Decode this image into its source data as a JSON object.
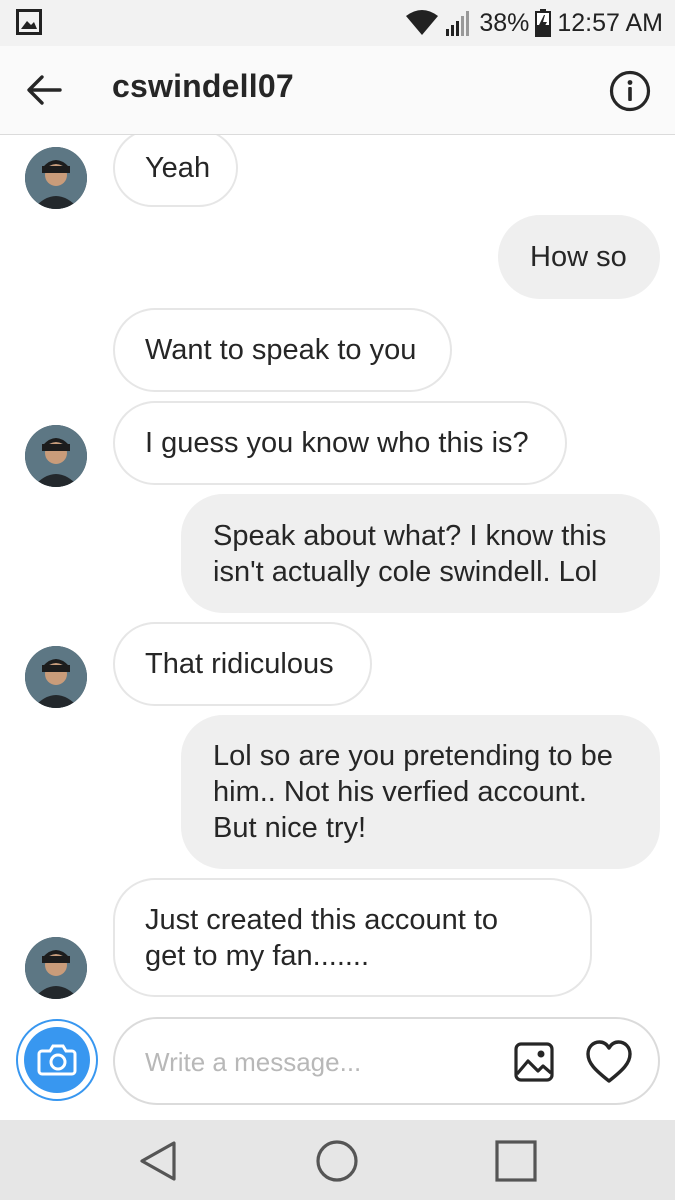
{
  "status_bar": {
    "battery": "38%",
    "time": "12:57 AM",
    "icons": [
      "image-notification-icon",
      "wifi-icon",
      "signal-icon",
      "battery-charging-icon"
    ]
  },
  "header": {
    "username": "cswindell07",
    "back_icon": "arrow-left-icon",
    "info_icon": "info-circle-icon"
  },
  "messages": [
    {
      "side": "in",
      "text": "Yeah",
      "avatar": true
    },
    {
      "side": "out",
      "text": "How so",
      "avatar": false
    },
    {
      "side": "in",
      "text": "Want to speak to you",
      "avatar": false
    },
    {
      "side": "in",
      "text": "I guess you know who this is?",
      "avatar": true
    },
    {
      "side": "out",
      "text": "Speak about what? I know this\nisn't actually cole swindell. Lol",
      "avatar": false
    },
    {
      "side": "in",
      "text": "That ridiculous",
      "avatar": true
    },
    {
      "side": "out",
      "text": "Lol so are you pretending to be\nhim.. Not his verfied account.\nBut nice try!",
      "avatar": false
    },
    {
      "side": "in",
      "text": "Just created this account to\nget to my fan.......",
      "avatar": true
    }
  ],
  "composer": {
    "placeholder": "Write a message...",
    "camera_icon": "camera-icon",
    "gallery_icon": "gallery-icon",
    "heart_icon": "heart-icon"
  },
  "colors": {
    "accent": "#3897f0",
    "outgoing_bubble": "#efefef",
    "incoming_border": "#e6e6e6"
  },
  "nav": {
    "icons": [
      "nav-back-icon",
      "nav-home-icon",
      "nav-recents-icon"
    ]
  }
}
